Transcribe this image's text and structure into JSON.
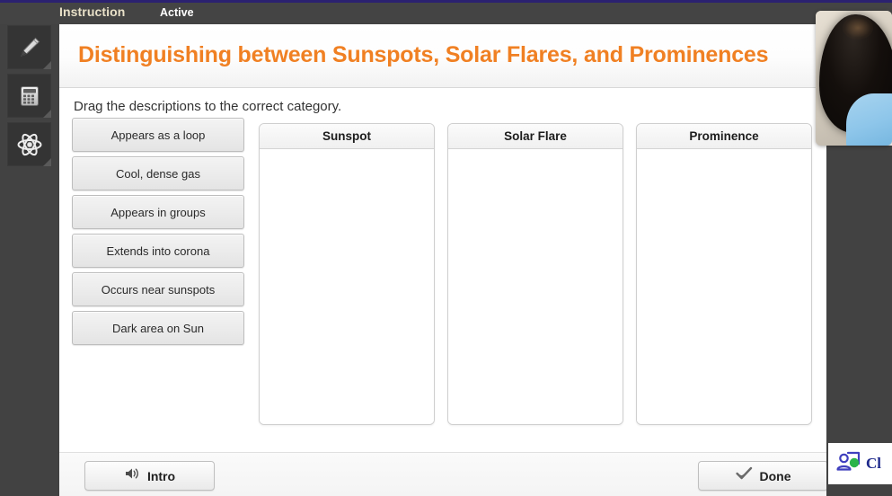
{
  "window": {
    "accent_strip_color": "#2b2170",
    "chrome_color": "#424242"
  },
  "topbar": {
    "instruction_tab": "Instruction",
    "active_tab": "Active"
  },
  "sidebar": {
    "tools": [
      {
        "name": "pencil-tool",
        "icon": "pencil-icon"
      },
      {
        "name": "calculator-tool",
        "icon": "calculator-icon"
      },
      {
        "name": "atom-tool",
        "icon": "atom-icon"
      }
    ]
  },
  "page": {
    "title": "Distinguishing between Sunspots, Solar Flares, and Prominences",
    "title_color": "#f08023",
    "instruction": "Drag the descriptions to the correct category."
  },
  "draggables": [
    {
      "label": "Appears as a loop"
    },
    {
      "label": "Cool, dense gas"
    },
    {
      "label": "Appears in groups"
    },
    {
      "label": "Extends into corona"
    },
    {
      "label": "Occurs near sunspots"
    },
    {
      "label": "Dark area on Sun"
    }
  ],
  "categories": [
    {
      "title": "Sunspot",
      "items": []
    },
    {
      "title": "Solar Flare",
      "items": []
    },
    {
      "title": "Prominence",
      "items": []
    }
  ],
  "footer": {
    "intro_label": "Intro",
    "intro_icon": "speaker-icon",
    "done_label": "Done",
    "done_icon": "check-icon"
  },
  "overlays": {
    "webcam": {
      "name": "webcam-video-feed"
    },
    "status_widget": {
      "label": "Cl",
      "icon": "user-presence-icon",
      "presence_color": "#2ab34a",
      "icon_color": "#3f3fbe"
    }
  }
}
